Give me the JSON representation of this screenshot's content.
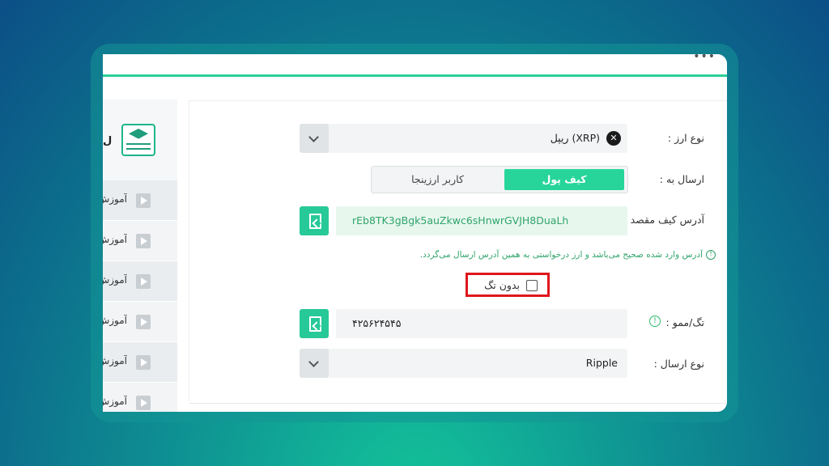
{
  "window": {
    "menu_dots": "•••"
  },
  "sidebar": {
    "header_letter": "ل",
    "items": [
      {
        "label": "آموزش"
      },
      {
        "label": "آموزش"
      },
      {
        "label": "آموزش"
      },
      {
        "label": "آموزش"
      },
      {
        "label": "آموزش"
      },
      {
        "label": "آموزش"
      }
    ]
  },
  "form": {
    "currency": {
      "label": "نوع ارز :",
      "value": "ریپل (XRP)"
    },
    "send_to": {
      "label": "ارسال به :",
      "options": [
        "کیف پول",
        "کاربر ارزینجا"
      ],
      "selected": "کیف پول"
    },
    "address": {
      "label": "آدرس کیف مقصد :",
      "value": "rEb8TK3gBgk5auZkwc6sHnwrGVJH8DuaLh"
    },
    "note": "آدرس وارد شده صحیح می‌باشد و ارز درخواستی به همین آدرس ارسال می‌گردد.",
    "no_tag": {
      "label": "بدون تگ",
      "checked": false
    },
    "memo": {
      "label": "تگ/ممو :",
      "value": "۴۲۵۶۲۴۵۴۵"
    },
    "send_type": {
      "label": "نوع ارسال :",
      "value": "Ripple"
    }
  },
  "colors": {
    "accent": "#27d59b",
    "highlight": "#e0161c"
  }
}
